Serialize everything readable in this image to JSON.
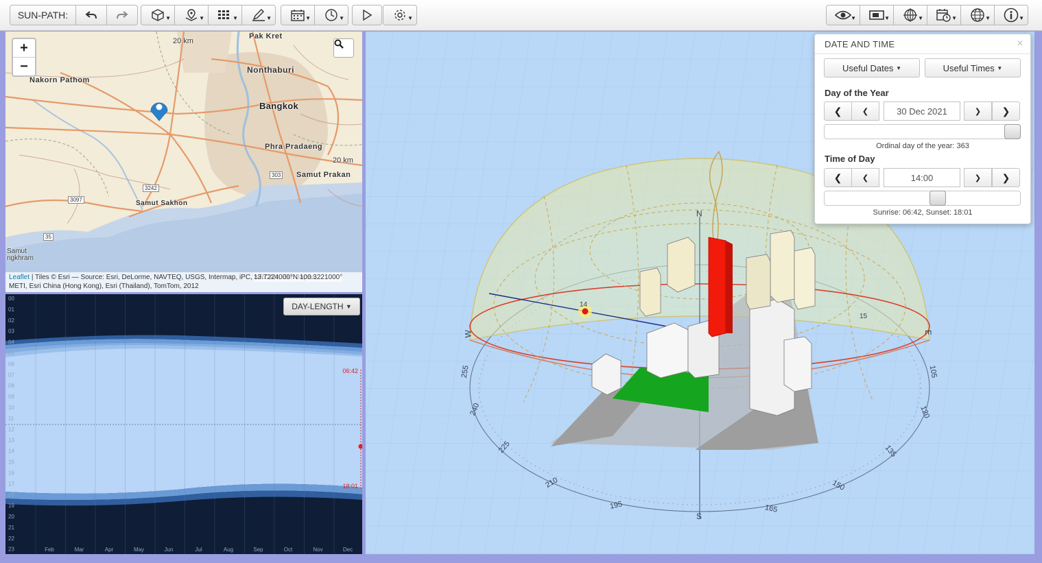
{
  "toolbar": {
    "app_label": "SUN-PATH:",
    "groups_left": [
      "undo",
      "redo"
    ],
    "icons_left": [
      "cube-icon",
      "map-marker-icon",
      "grid-icon",
      "pencil-icon",
      "calendar-icon",
      "clock-icon",
      "play-icon",
      "gear-icon"
    ],
    "icons_right": [
      "eye-icon",
      "display-icon",
      "globe-crosshair-icon",
      "calendar-clock-icon",
      "globe-icon",
      "info-icon"
    ]
  },
  "map": {
    "zoom_in": "+",
    "zoom_out": "−",
    "labels": {
      "pak_kret": "Pak Kret",
      "nonthaburi": "Nonthaburi",
      "nakorn_pathom": "Nakorn Pathom",
      "bangkok": "Bangkok",
      "phra_pradaeng": "Phra Pradaeng",
      "samut_prakan": "Samut Prakan",
      "samut_sakhon": "Samut Sakhon",
      "samut_songkhram": "Samut\nngkhram",
      "scale_top": "20 km",
      "scale_right": "20 km",
      "road_3242": "3242",
      "road_303": "303",
      "road_3097": "3097",
      "road_35": "35"
    },
    "attribution_link": "Leaflet",
    "attribution_line1": "| Tiles © Esri — Source: Esri, DeLorme, NAVTEQ, USGS, Intermap, iPC, NRCAN, Esri Japan,",
    "attribution_line2": "METI, Esri China (Hong Kong), Esri (Thailand), TomTom, 2012",
    "coords": "13.7224000°N 100.3221000°"
  },
  "daylength": {
    "button": "DAY-LENGTH",
    "hours": [
      "00",
      "01",
      "02",
      "03",
      "04",
      "05",
      "06",
      "07",
      "08",
      "09",
      "10",
      "11",
      "12",
      "13",
      "14",
      "15",
      "16",
      "17",
      "18",
      "19",
      "20",
      "21",
      "22",
      "23"
    ],
    "months": [
      "Feb",
      "Mar",
      "Apr",
      "May",
      "Jun",
      "Jul",
      "Aug",
      "Sep",
      "Oct",
      "Nov",
      "Dec"
    ],
    "sunrise_marker": "06:42",
    "sunset_marker": "18:01"
  },
  "scene": {
    "compass": {
      "north": "N",
      "south": "S",
      "east": "E",
      "west": "W"
    },
    "azimuth_labels": [
      "255",
      "240",
      "225",
      "210",
      "195",
      "165",
      "150",
      "135",
      "120",
      "105"
    ],
    "hour_labels": [
      "14",
      "15"
    ]
  },
  "datetime": {
    "title": "DATE AND TIME",
    "close": "×",
    "useful_dates": "Useful Dates",
    "useful_times": "Useful Times",
    "day_section": "Day of the Year",
    "date_value": "30 Dec 2021",
    "ordinal_text": "Ordinal day of the year: 363",
    "ordinal_day": 363,
    "time_section": "Time of Day",
    "time_value": "14:00",
    "time_fraction": 0.583,
    "sun_text": "Sunrise: 06:42,   Sunset: 18:01"
  }
}
